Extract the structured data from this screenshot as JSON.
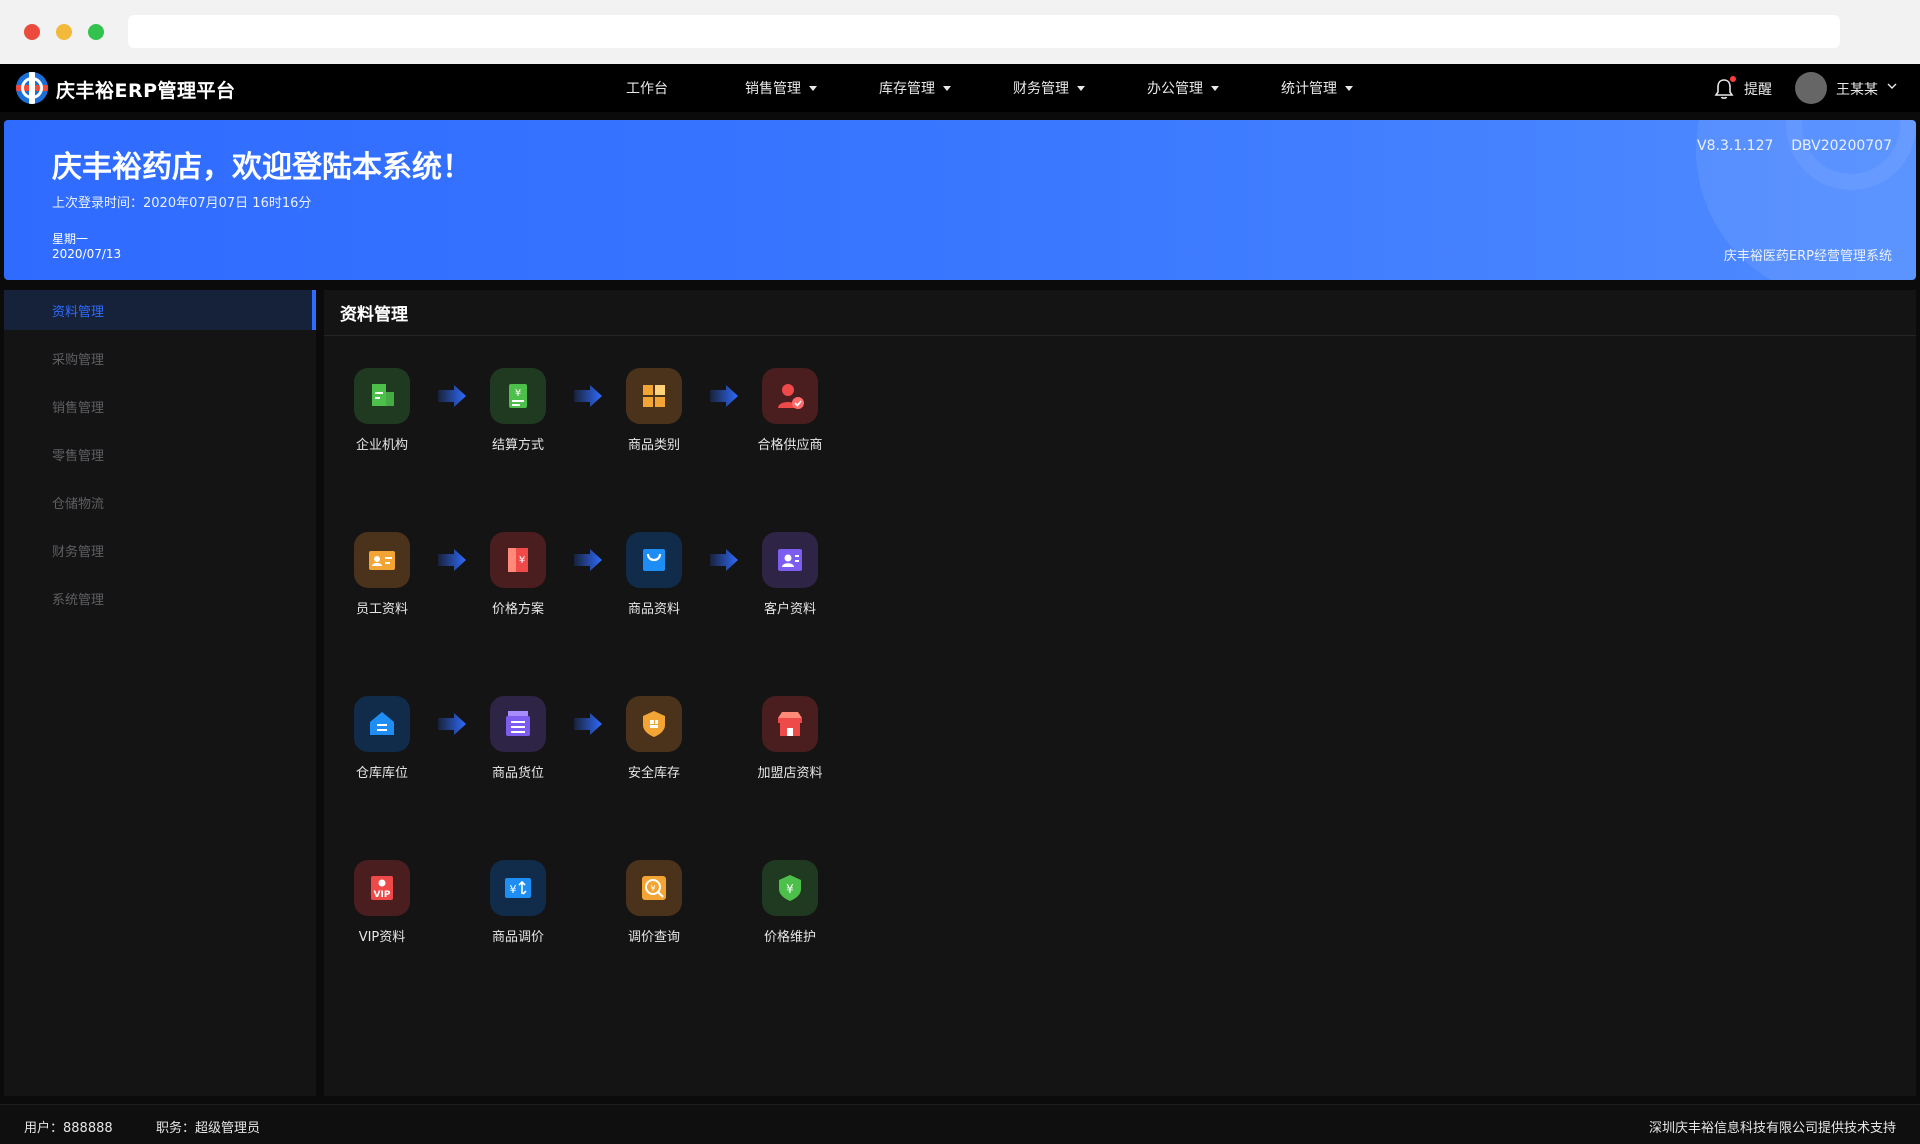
{
  "app": {
    "brand": "庆丰裕ERP管理平台"
  },
  "nav": {
    "items": [
      {
        "label": "工作台",
        "dropdown": false
      },
      {
        "label": "销售管理",
        "dropdown": true
      },
      {
        "label": "库存管理",
        "dropdown": true
      },
      {
        "label": "财务管理",
        "dropdown": true
      },
      {
        "label": "办公管理",
        "dropdown": true
      },
      {
        "label": "统计管理",
        "dropdown": true
      }
    ],
    "remind_label": "提醒",
    "username": "王某某",
    "icons": {
      "bell": "bell-icon",
      "user_menu": "chevron-down-icon"
    }
  },
  "banner": {
    "welcome": "庆丰裕药店，欢迎登陆本系统！",
    "last_login": "上次登录时间：2020年07月07日 16时16分",
    "weekday": "星期一",
    "date": "2020/07/13",
    "version": "V8.3.1.127    DBV20200707",
    "system_name": "庆丰裕医药ERP经营管理系统"
  },
  "sidebar": {
    "items": [
      {
        "label": "资料管理",
        "active": true
      },
      {
        "label": "采购管理",
        "active": false
      },
      {
        "label": "销售管理",
        "active": false
      },
      {
        "label": "零售管理",
        "active": false
      },
      {
        "label": "仓储物流",
        "active": false
      },
      {
        "label": "财务管理",
        "active": false
      },
      {
        "label": "系统管理",
        "active": false
      }
    ]
  },
  "main": {
    "title": "资料管理",
    "tiles": [
      {
        "label": "企业机构",
        "icon": "building-icon",
        "bg": "b-green",
        "color": "#4cc04a"
      },
      {
        "label": "结算方式",
        "icon": "yuan-receipt-icon",
        "bg": "b-green",
        "color": "#4cc04a"
      },
      {
        "label": "商品类别",
        "icon": "grid-icon",
        "bg": "b-orange",
        "color": "#f2a535"
      },
      {
        "label": "合格供应商",
        "icon": "verified-user-icon",
        "bg": "b-red",
        "color": "#ef4a4a"
      },
      {
        "label": "员工资料",
        "icon": "id-card-icon",
        "bg": "b-orange",
        "color": "#f2a535"
      },
      {
        "label": "价格方案",
        "icon": "price-book-icon",
        "bg": "b-red",
        "color": "#ef4a4a"
      },
      {
        "label": "商品资料",
        "icon": "shopping-bag-icon",
        "bg": "b-blue",
        "color": "#1e8ef5"
      },
      {
        "label": "客户资料",
        "icon": "contact-card-icon",
        "bg": "b-purple",
        "color": "#7d5cf0"
      },
      {
        "label": "仓库库位",
        "icon": "warehouse-icon",
        "bg": "b-blue",
        "color": "#1e8ef5"
      },
      {
        "label": "商品货位",
        "icon": "shelf-box-icon",
        "bg": "b-purple",
        "color": "#7d5cf0"
      },
      {
        "label": "安全库存",
        "icon": "shield-box-icon",
        "bg": "b-orange",
        "color": "#f2a535"
      },
      {
        "label": "加盟店资料",
        "icon": "store-icon",
        "bg": "b-red",
        "color": "#ef4a4a"
      },
      {
        "label": "VIP资料",
        "icon": "vip-card-icon",
        "bg": "b-red",
        "color": "#ef4a4a"
      },
      {
        "label": "商品调价",
        "icon": "price-adjust-icon",
        "bg": "b-blue",
        "color": "#1e8ef5"
      },
      {
        "label": "调价查询",
        "icon": "price-search-icon",
        "bg": "b-orange",
        "color": "#f2a535"
      },
      {
        "label": "价格维护",
        "icon": "yuan-shield-icon",
        "bg": "b-green",
        "color": "#4cc04a"
      }
    ],
    "arrows_after": [
      0,
      1,
      2,
      4,
      5,
      6,
      8,
      9
    ]
  },
  "footer": {
    "user": "用户：888888",
    "role": "职务：超级管理员",
    "support": "深圳庆丰裕信息科技有限公司提供技术支持"
  },
  "colors": {
    "accent": "#2f6bff",
    "banner_start": "#2f6bff",
    "banner_end": "#4f8bff",
    "panel_bg": "#141415",
    "arrow": "#2f6bff"
  }
}
